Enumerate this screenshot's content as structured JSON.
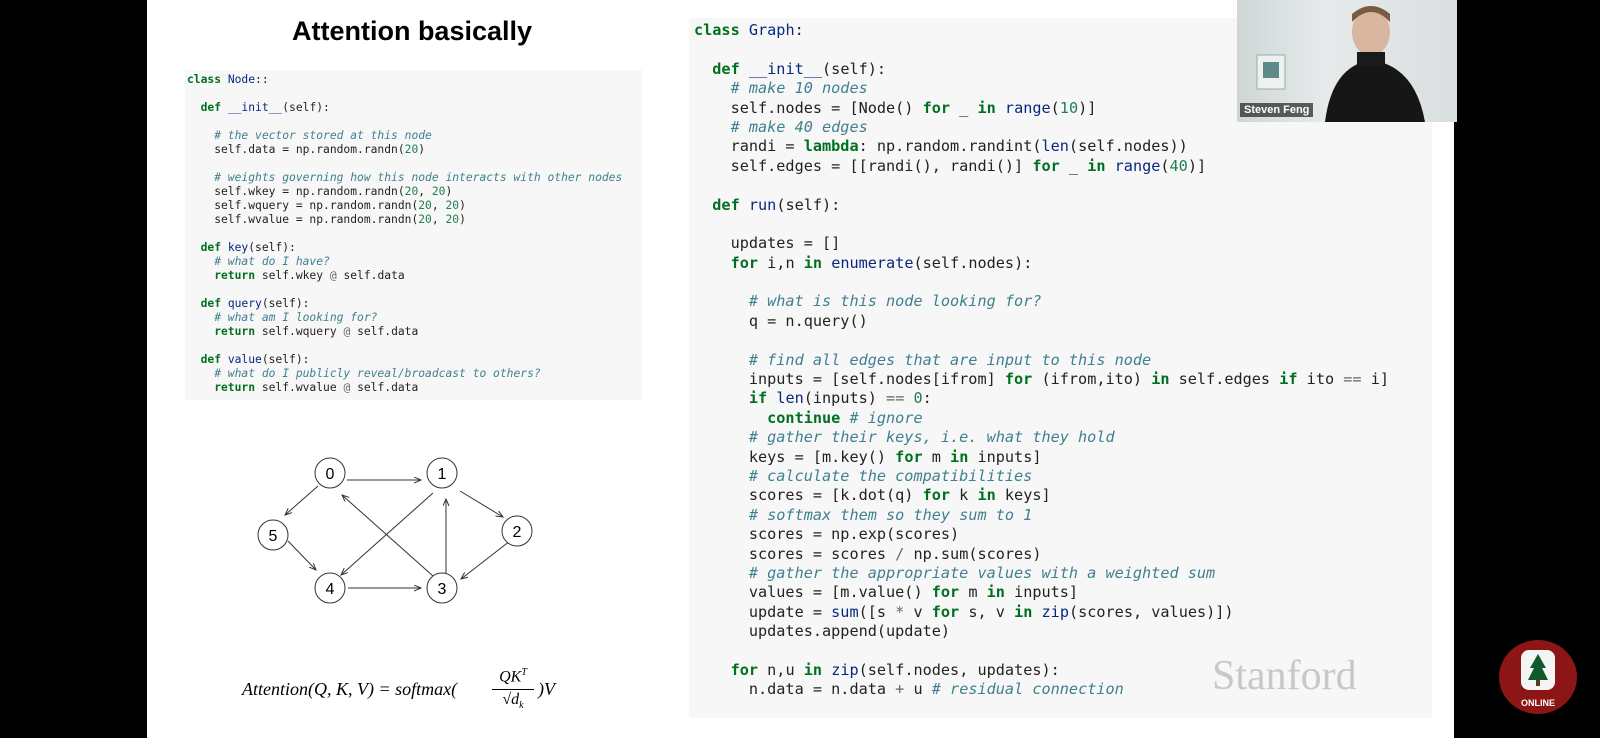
{
  "slide_title": "Attention basically",
  "left_code": [
    [
      [
        "kw",
        "class "
      ],
      [
        "fn",
        "Node"
      ],
      [
        "",
        "::"
      ]
    ],
    [
      [
        "",
        ""
      ]
    ],
    [
      [
        "kw",
        "  def "
      ],
      [
        "fn",
        "__init__"
      ],
      [
        "",
        "(self):"
      ]
    ],
    [
      [
        "",
        ""
      ]
    ],
    [
      [
        "cm",
        "    # the vector stored at this node"
      ]
    ],
    [
      [
        "",
        "    self.data = np.random.randn("
      ],
      [
        "nm",
        "20"
      ],
      [
        "",
        ")"
      ]
    ],
    [
      [
        "",
        ""
      ]
    ],
    [
      [
        "cm",
        "    # weights governing how this node interacts with other nodes"
      ]
    ],
    [
      [
        "",
        "    self.wkey = np.random.randn("
      ],
      [
        "nm",
        "20"
      ],
      [
        "",
        ", "
      ],
      [
        "nm",
        "20"
      ],
      [
        "",
        ")"
      ]
    ],
    [
      [
        "",
        "    self.wquery = np.random.randn("
      ],
      [
        "nm",
        "20"
      ],
      [
        "",
        ", "
      ],
      [
        "nm",
        "20"
      ],
      [
        "",
        ")"
      ]
    ],
    [
      [
        "",
        "    self.wvalue = np.random.randn("
      ],
      [
        "nm",
        "20"
      ],
      [
        "",
        ", "
      ],
      [
        "nm",
        "20"
      ],
      [
        "",
        ")"
      ]
    ],
    [
      [
        "",
        ""
      ]
    ],
    [
      [
        "kw",
        "  def "
      ],
      [
        "fn",
        "key"
      ],
      [
        "",
        "(self):"
      ]
    ],
    [
      [
        "cm",
        "    # what do I have?"
      ]
    ],
    [
      [
        "kw",
        "    return "
      ],
      [
        "",
        "self.wkey "
      ],
      [
        "op",
        "@"
      ],
      [
        "",
        " self.data"
      ]
    ],
    [
      [
        "",
        ""
      ]
    ],
    [
      [
        "kw",
        "  def "
      ],
      [
        "fn",
        "query"
      ],
      [
        "",
        "(self):"
      ]
    ],
    [
      [
        "cm",
        "    # what am I looking for?"
      ]
    ],
    [
      [
        "kw",
        "    return "
      ],
      [
        "",
        "self.wquery "
      ],
      [
        "op",
        "@"
      ],
      [
        "",
        " self.data"
      ]
    ],
    [
      [
        "",
        ""
      ]
    ],
    [
      [
        "kw",
        "  def "
      ],
      [
        "fn",
        "value"
      ],
      [
        "",
        "(self):"
      ]
    ],
    [
      [
        "cm",
        "    # what do I publicly reveal/broadcast to others?"
      ]
    ],
    [
      [
        "kw",
        "    return "
      ],
      [
        "",
        "self.wvalue "
      ],
      [
        "op",
        "@"
      ],
      [
        "",
        " self.data"
      ]
    ]
  ],
  "right_code": [
    [
      [
        "kw",
        "class "
      ],
      [
        "fn",
        "Graph"
      ],
      [
        "",
        ":"
      ]
    ],
    [
      [
        "",
        ""
      ]
    ],
    [
      [
        "kw",
        "  def "
      ],
      [
        "fn",
        "__init__"
      ],
      [
        "",
        "(self):"
      ]
    ],
    [
      [
        "cm",
        "    # make 10 nodes"
      ]
    ],
    [
      [
        "",
        "    self.nodes = [Node() "
      ],
      [
        "kw",
        "for"
      ],
      [
        "",
        " _ "
      ],
      [
        "kw",
        "in"
      ],
      [
        "",
        " "
      ],
      [
        "fn",
        "range"
      ],
      [
        "",
        "("
      ],
      [
        "nm",
        "10"
      ],
      [
        "",
        ")]"
      ]
    ],
    [
      [
        "cm",
        "    # make 40 edges"
      ]
    ],
    [
      [
        "",
        "    randi = "
      ],
      [
        "kw",
        "lambda"
      ],
      [
        "",
        ": np.random.randint("
      ],
      [
        "fn",
        "len"
      ],
      [
        "",
        "(self.nodes))"
      ]
    ],
    [
      [
        "",
        "    self.edges = [[randi(), randi()] "
      ],
      [
        "kw",
        "for"
      ],
      [
        "",
        " _ "
      ],
      [
        "kw",
        "in"
      ],
      [
        "",
        " "
      ],
      [
        "fn",
        "range"
      ],
      [
        "",
        "("
      ],
      [
        "nm",
        "40"
      ],
      [
        "",
        ")]"
      ]
    ],
    [
      [
        "",
        ""
      ]
    ],
    [
      [
        "kw",
        "  def "
      ],
      [
        "fn",
        "run"
      ],
      [
        "",
        "(self):"
      ]
    ],
    [
      [
        "",
        ""
      ]
    ],
    [
      [
        "",
        "    updates = []"
      ]
    ],
    [
      [
        "kw",
        "    for"
      ],
      [
        "",
        " i,n "
      ],
      [
        "kw",
        "in"
      ],
      [
        "",
        " "
      ],
      [
        "fn",
        "enumerate"
      ],
      [
        "",
        "(self.nodes):"
      ]
    ],
    [
      [
        "",
        ""
      ]
    ],
    [
      [
        "cm",
        "      # what is this node looking for?"
      ]
    ],
    [
      [
        "",
        "      q = n.query()"
      ]
    ],
    [
      [
        "",
        ""
      ]
    ],
    [
      [
        "cm",
        "      # find all edges that are input to this node"
      ]
    ],
    [
      [
        "",
        "      inputs = [self.nodes[ifrom] "
      ],
      [
        "kw",
        "for"
      ],
      [
        "",
        " (ifrom,ito) "
      ],
      [
        "kw",
        "in"
      ],
      [
        "",
        " self.edges "
      ],
      [
        "kw",
        "if"
      ],
      [
        "",
        " ito "
      ],
      [
        "op",
        "=="
      ],
      [
        "",
        " i]"
      ]
    ],
    [
      [
        "kw",
        "      if"
      ],
      [
        "",
        " "
      ],
      [
        "fn",
        "len"
      ],
      [
        "",
        "(inputs) "
      ],
      [
        "op",
        "=="
      ],
      [
        "",
        " "
      ],
      [
        "nm",
        "0"
      ],
      [
        "",
        ":"
      ]
    ],
    [
      [
        "kw",
        "        continue"
      ],
      [
        "cm",
        " # ignore"
      ]
    ],
    [
      [
        "cm",
        "      # gather their keys, i.e. what they hold"
      ]
    ],
    [
      [
        "",
        "      keys = [m.key() "
      ],
      [
        "kw",
        "for"
      ],
      [
        "",
        " m "
      ],
      [
        "kw",
        "in"
      ],
      [
        "",
        " inputs]"
      ]
    ],
    [
      [
        "cm",
        "      # calculate the compatibilities"
      ]
    ],
    [
      [
        "",
        "      scores = [k.dot(q) "
      ],
      [
        "kw",
        "for"
      ],
      [
        "",
        " k "
      ],
      [
        "kw",
        "in"
      ],
      [
        "",
        " keys]"
      ]
    ],
    [
      [
        "cm",
        "      # softmax them so they sum to 1"
      ]
    ],
    [
      [
        "",
        "      scores = np.exp(scores)"
      ]
    ],
    [
      [
        "",
        "      scores = scores "
      ],
      [
        "op",
        "/"
      ],
      [
        "",
        " np.sum(scores)"
      ]
    ],
    [
      [
        "cm",
        "      # gather the appropriate values with a weighted sum"
      ]
    ],
    [
      [
        "",
        "      values = [m.value() "
      ],
      [
        "kw",
        "for"
      ],
      [
        "",
        " m "
      ],
      [
        "kw",
        "in"
      ],
      [
        "",
        " inputs]"
      ]
    ],
    [
      [
        "",
        "      update = "
      ],
      [
        "fn",
        "sum"
      ],
      [
        "",
        "([s "
      ],
      [
        "op",
        "*"
      ],
      [
        "",
        " v "
      ],
      [
        "kw",
        "for"
      ],
      [
        "",
        " s, v "
      ],
      [
        "kw",
        "in"
      ],
      [
        "",
        " "
      ],
      [
        "fn",
        "zip"
      ],
      [
        "",
        "(scores, values)])"
      ]
    ],
    [
      [
        "",
        "      updates.append(update)"
      ]
    ],
    [
      [
        "",
        ""
      ]
    ],
    [
      [
        "kw",
        "    for"
      ],
      [
        "",
        " n,u "
      ],
      [
        "kw",
        "in"
      ],
      [
        "",
        " "
      ],
      [
        "fn",
        "zip"
      ],
      [
        "",
        "(self.nodes, updates):"
      ]
    ],
    [
      [
        "",
        "      n.data = n.data "
      ],
      [
        "op",
        "+"
      ],
      [
        "",
        " u "
      ],
      [
        "cm",
        "# residual connection"
      ]
    ]
  ],
  "graph": {
    "nodes": [
      "0",
      "1",
      "2",
      "3",
      "4",
      "5"
    ]
  },
  "formula": {
    "lhs": "Attention(Q, K, V) = softmax(",
    "num": "QK",
    "num_sup": "T",
    "den": "√d",
    "den_sub": "k",
    "rhs": ")V"
  },
  "webcam": {
    "name": "Steven Feng"
  },
  "watermark": "Stanford",
  "logo_text": "ONLINE",
  "colors": {
    "slide_bg": "#ffffff",
    "code_bg": "#f7f7f7",
    "keyword": "#007020",
    "comment": "#408090",
    "stanford_red": "#8c1515"
  }
}
